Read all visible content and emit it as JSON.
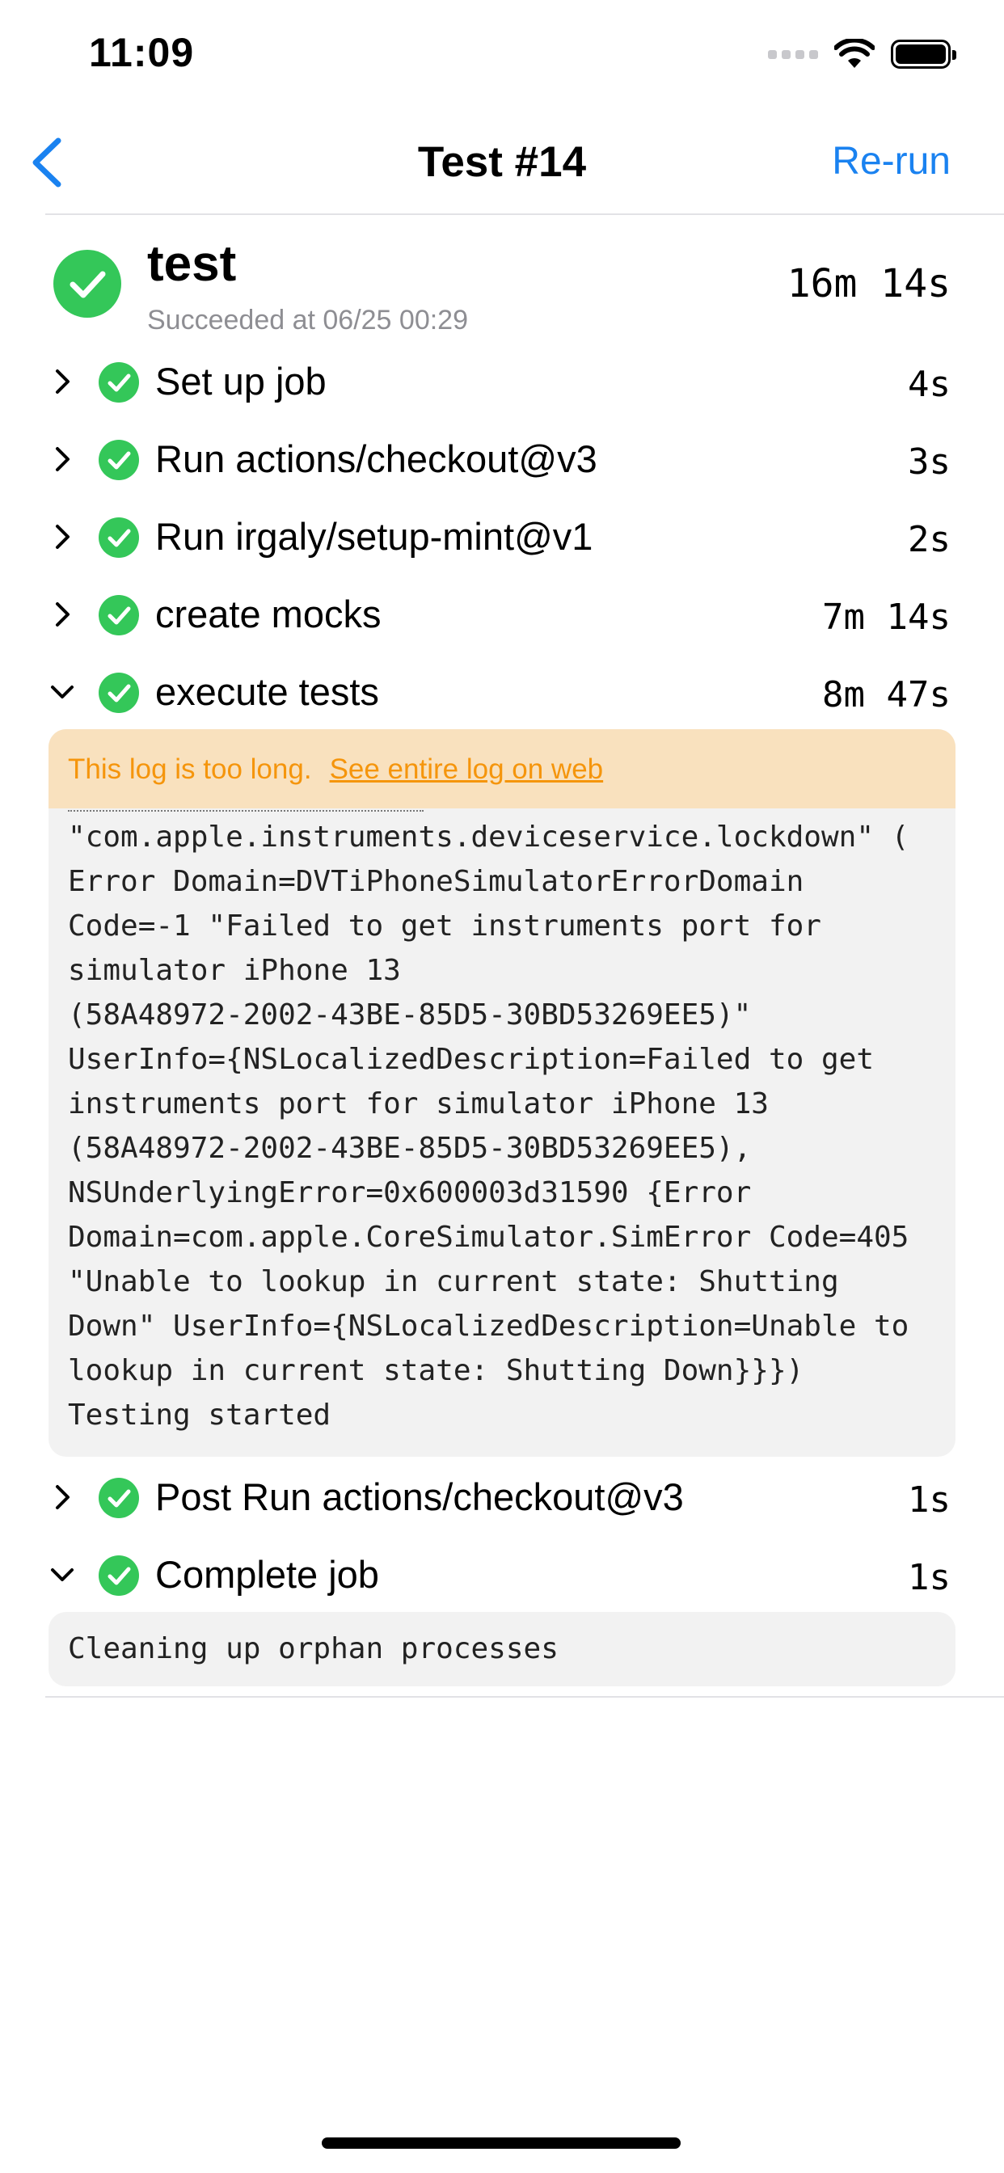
{
  "status_bar": {
    "time": "11:09"
  },
  "nav": {
    "title": "Test #14",
    "action": "Re-run"
  },
  "job": {
    "name": "test",
    "subtitle": "Succeeded at 06/25 00:29",
    "duration": "16m 14s"
  },
  "steps": [
    {
      "label": "Set up job",
      "time": "4s",
      "expanded": false
    },
    {
      "label": "Run actions/checkout@v3",
      "time": "3s",
      "expanded": false
    },
    {
      "label": "Run irgaly/setup-mint@v1",
      "time": "2s",
      "expanded": false
    },
    {
      "label": "create mocks",
      "time": "7m 14s",
      "expanded": false
    },
    {
      "label": "execute tests",
      "time": "8m 47s",
      "expanded": true
    },
    {
      "label": "Post Run actions/checkout@v3",
      "time": "1s",
      "expanded": false
    },
    {
      "label": "Complete job",
      "time": "1s",
      "expanded": true
    }
  ],
  "log_warning": {
    "text": "This log is too long.",
    "link": "See entire log on web"
  },
  "execute_log": [
    "\"com.apple.instruments.deviceservice.lockdown\" (",
    "Error Domain=DVTiPhoneSimulatorErrorDomain",
    "Code=-1 \"Failed to get instruments port for",
    "simulator iPhone 13",
    "(58A48972-2002-43BE-85D5-30BD53269EE5)\"",
    "UserInfo={NSLocalizedDescription=Failed to get",
    "instruments port for simulator iPhone 13",
    "(58A48972-2002-43BE-85D5-30BD53269EE5),",
    "NSUnderlyingError=0x600003d31590 {Error",
    "Domain=com.apple.CoreSimulator.SimError Code=405",
    "\"Unable to lookup in current state: Shutting",
    "Down\" UserInfo={NSLocalizedDescription=Unable to",
    "lookup in current state: Shutting Down}}})",
    "Testing started"
  ],
  "complete_log": "Cleaning up orphan processes",
  "colors": {
    "accent": "#1a82f0",
    "success": "#34c759",
    "warning_bg": "#f9e1be",
    "warning_text": "#f5950c",
    "log_bg": "#f2f2f2"
  }
}
